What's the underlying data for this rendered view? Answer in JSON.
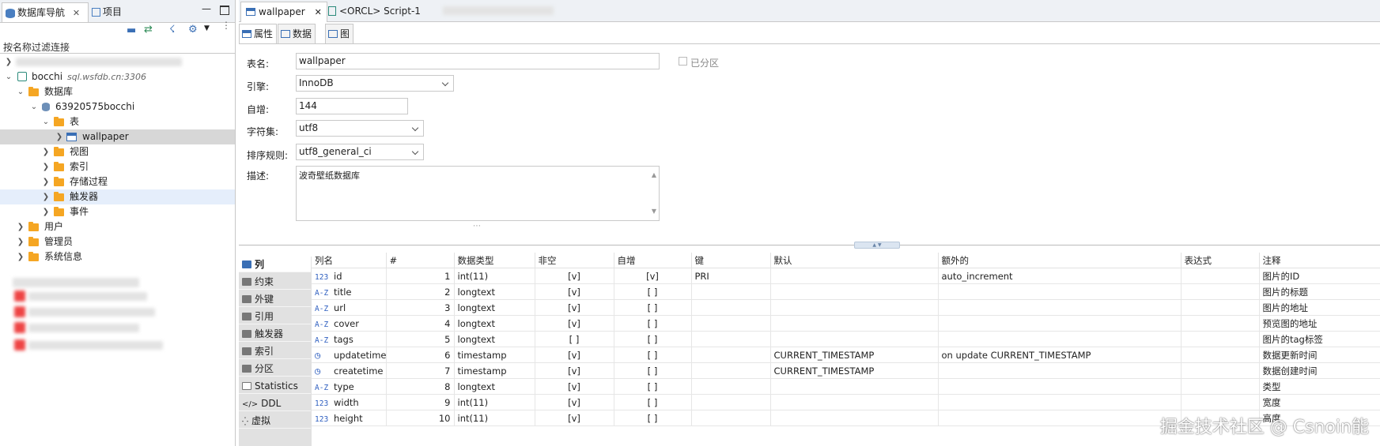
{
  "left_panel": {
    "tabs": [
      {
        "label": "数据库导航",
        "close": "✕"
      },
      {
        "label": "项目"
      }
    ],
    "filter_placeholder": "按名称过滤连接",
    "tree": {
      "connection": {
        "name": "bocchi",
        "host": "sql.wsfdb.cn:3306"
      },
      "databases_label": "数据库",
      "schema": "63920575bocchi",
      "tables_label": "表",
      "table_item": "wallpaper",
      "children": [
        "视图",
        "索引",
        "存储过程",
        "触发器",
        "事件"
      ],
      "conn_children": [
        "用户",
        "管理员",
        "系统信息"
      ]
    }
  },
  "editor": {
    "tabs": [
      {
        "label": "wallpaper",
        "close": "✕"
      },
      {
        "label": "<ORCL> Script-1"
      }
    ],
    "subtabs": [
      "属性",
      "数据",
      "图"
    ],
    "form": {
      "table_name_label": "表名:",
      "table_name": "wallpaper",
      "partitioned_label": "已分区",
      "engine_label": "引擎:",
      "engine": "InnoDB",
      "autoinc_label": "自增:",
      "autoinc": "144",
      "charset_label": "字符集:",
      "charset": "utf8",
      "collation_label": "排序规则:",
      "collation": "utf8_general_ci",
      "desc_label": "描述:",
      "description": "波奇壁纸数据库"
    },
    "side_tabs": [
      "列",
      "约束",
      "外键",
      "引用",
      "触发器",
      "索引",
      "分区",
      "Statistics",
      "DDL",
      "虚拟"
    ],
    "columns_header": [
      "列名",
      "#",
      "数据类型",
      "非空",
      "自增",
      "键",
      "默认",
      "额外的",
      "表达式",
      "注释"
    ],
    "columns": [
      {
        "icon": "123",
        "name": "id",
        "num": "1",
        "type": "int(11)",
        "notnull": "[v]",
        "autoinc": "[v]",
        "key": "PRI",
        "default": "",
        "extra": "auto_increment",
        "expr": "",
        "comment": "图片的ID"
      },
      {
        "icon": "A-Z",
        "name": "title",
        "num": "2",
        "type": "longtext",
        "notnull": "[v]",
        "autoinc": "[ ]",
        "key": "",
        "default": "",
        "extra": "",
        "expr": "",
        "comment": "图片的标题"
      },
      {
        "icon": "A-Z",
        "name": "url",
        "num": "3",
        "type": "longtext",
        "notnull": "[v]",
        "autoinc": "[ ]",
        "key": "",
        "default": "",
        "extra": "",
        "expr": "",
        "comment": "图片的地址"
      },
      {
        "icon": "A-Z",
        "name": "cover",
        "num": "4",
        "type": "longtext",
        "notnull": "[v]",
        "autoinc": "[ ]",
        "key": "",
        "default": "",
        "extra": "",
        "expr": "",
        "comment": "预览图的地址"
      },
      {
        "icon": "A-Z",
        "name": "tags",
        "num": "5",
        "type": "longtext",
        "notnull": "[ ]",
        "autoinc": "[ ]",
        "key": "",
        "default": "",
        "extra": "",
        "expr": "",
        "comment": "图片的tag标签"
      },
      {
        "icon": "clock",
        "name": "updatetime",
        "num": "6",
        "type": "timestamp",
        "notnull": "[v]",
        "autoinc": "[ ]",
        "key": "",
        "default": "CURRENT_TIMESTAMP",
        "extra": "on update CURRENT_TIMESTAMP",
        "expr": "",
        "comment": "数据更新时间"
      },
      {
        "icon": "clock",
        "name": "createtime",
        "num": "7",
        "type": "timestamp",
        "notnull": "[v]",
        "autoinc": "[ ]",
        "key": "",
        "default": "CURRENT_TIMESTAMP",
        "extra": "",
        "expr": "",
        "comment": "数据创建时间"
      },
      {
        "icon": "A-Z",
        "name": "type",
        "num": "8",
        "type": "longtext",
        "notnull": "[v]",
        "autoinc": "[ ]",
        "key": "",
        "default": "",
        "extra": "",
        "expr": "",
        "comment": "类型"
      },
      {
        "icon": "123",
        "name": "width",
        "num": "9",
        "type": "int(11)",
        "notnull": "[v]",
        "autoinc": "[ ]",
        "key": "",
        "default": "",
        "extra": "",
        "expr": "",
        "comment": "宽度"
      },
      {
        "icon": "123",
        "name": "height",
        "num": "10",
        "type": "int(11)",
        "notnull": "[v]",
        "autoinc": "[ ]",
        "key": "",
        "default": "",
        "extra": "",
        "expr": "",
        "comment": "高度"
      }
    ]
  },
  "watermark": "掘金技术社区 @ Csnoin能"
}
